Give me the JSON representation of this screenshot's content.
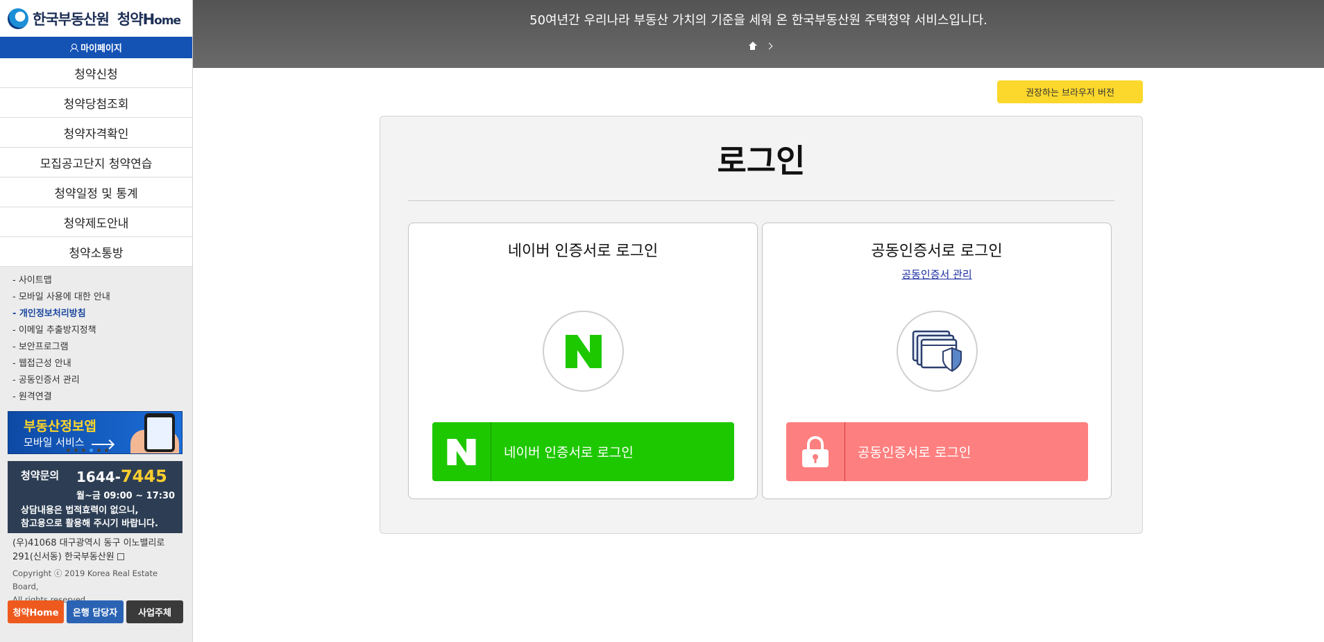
{
  "sidebar": {
    "logo": {
      "org": "한국부동산원",
      "service_main": "청약",
      "service_h": "H",
      "service_rest": "ome"
    },
    "mypage": "마이페이지",
    "menu": [
      "청약신청",
      "청약당첨조회",
      "청약자격확인",
      "모집공고단지 청약연습",
      "청약일정 및 통계",
      "청약제도안내",
      "청약소통방"
    ],
    "links": [
      "- 사이트맵",
      "- 모바일 사용에 대한 안내",
      "- 개인정보처리방침",
      "- 이메일 추출방지정책",
      "- 보안프로그램",
      "- 웹접근성 안내",
      "- 공동인증서 관리",
      "- 원격연결"
    ],
    "banner": {
      "line1": "부동산정보앱",
      "line2": "모바일 서비스"
    },
    "contact": {
      "label": "청약문의",
      "number_prefix": "1644-",
      "number_highlight": "7445",
      "hours": "월~금 09:00 ~ 17:30",
      "note_line1": "상담내용은 법적효력이 없으니,",
      "note_line2": "참고용으로 활용해 주시기 바랍니다."
    },
    "address_line1": "(우)41068 대구광역시 동구 이노밸리로",
    "address_line2": "291(신서동) 한국부동산원",
    "copyright_line1": "Copyright ⓒ 2019 Korea Real Estate Board,",
    "copyright_line2": "All rights reserved.",
    "buttons": [
      "청약Home",
      "은행 담당자",
      "사업주체"
    ]
  },
  "header": {
    "slogan": "50여년간 우리나라 부동산 가치의 기준을 세워 온 한국부동산원 주택청약 서비스입니다."
  },
  "browser_button": "권장하는 브라우저 버전",
  "login": {
    "title": "로그인",
    "naver": {
      "title": "네이버 인증서로 로그인",
      "button": "네이버 인증서로 로그인"
    },
    "cert": {
      "title": "공동인증서로 로그인",
      "manage_link": "공동인증서 관리",
      "button": "공동인증서로 로그인"
    }
  },
  "colors": {
    "naver_green": "#1ec800",
    "cert_pink": "#fe7f7f",
    "mypage_blue": "#1452b4",
    "browser_yellow": "#fcd82c"
  },
  "icons": [
    "home-icon",
    "chevron-right-icon",
    "naver-n-icon",
    "certificate-shield-icon",
    "padlock-icon",
    "person-icon",
    "external-link-icon"
  ]
}
